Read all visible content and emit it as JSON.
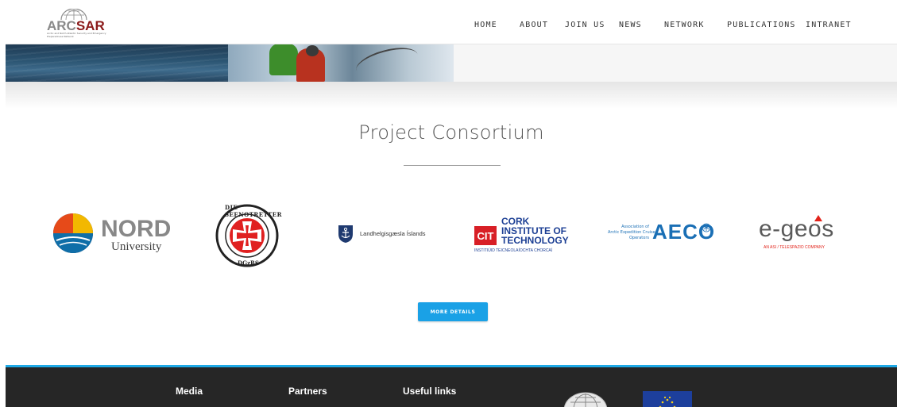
{
  "logo": {
    "name_part1": "ARC",
    "name_part2": "SAR",
    "tagline": "Arctic and North Atlantic Security and Emergency Preparedness Network"
  },
  "nav": {
    "items": [
      "HOME",
      "ABOUT",
      "JOIN US",
      "NEWS",
      "NETWORK",
      "PUBLICATIONS",
      "INTRANET"
    ]
  },
  "section": {
    "title": "Project Consortium"
  },
  "partners": {
    "nord": {
      "name": "NORD",
      "sub": "University"
    },
    "dgzrs": {
      "top": "DIE SEENOTRETTER",
      "bottom": "DGzRS"
    },
    "lhg": {
      "name": "Landhelgisgæsla Íslands"
    },
    "cit": {
      "abbr": "CIT",
      "line1": "CORK",
      "line2": "INSTITUTE OF",
      "line3": "TECHNOLOGY",
      "irish": "INSTITIÚID TEICNEOLAÍOCHTA CHORCAÍ"
    },
    "aeco": {
      "small1": "Association of",
      "small2": "Arctic Expedition Cruise",
      "small3": "Operators",
      "name": "AECO"
    },
    "egeos": {
      "name": "e-geos",
      "sub": "AN ASI / TELESPAZIO COMPANY"
    }
  },
  "button": {
    "label": "MORE DETAILS"
  },
  "footer": {
    "media": "Media",
    "partners": "Partners",
    "links": "Useful links"
  },
  "colors": {
    "accent": "#1aa1e6",
    "brand_red": "#8b1a1a",
    "footer_bg": "#262626"
  }
}
